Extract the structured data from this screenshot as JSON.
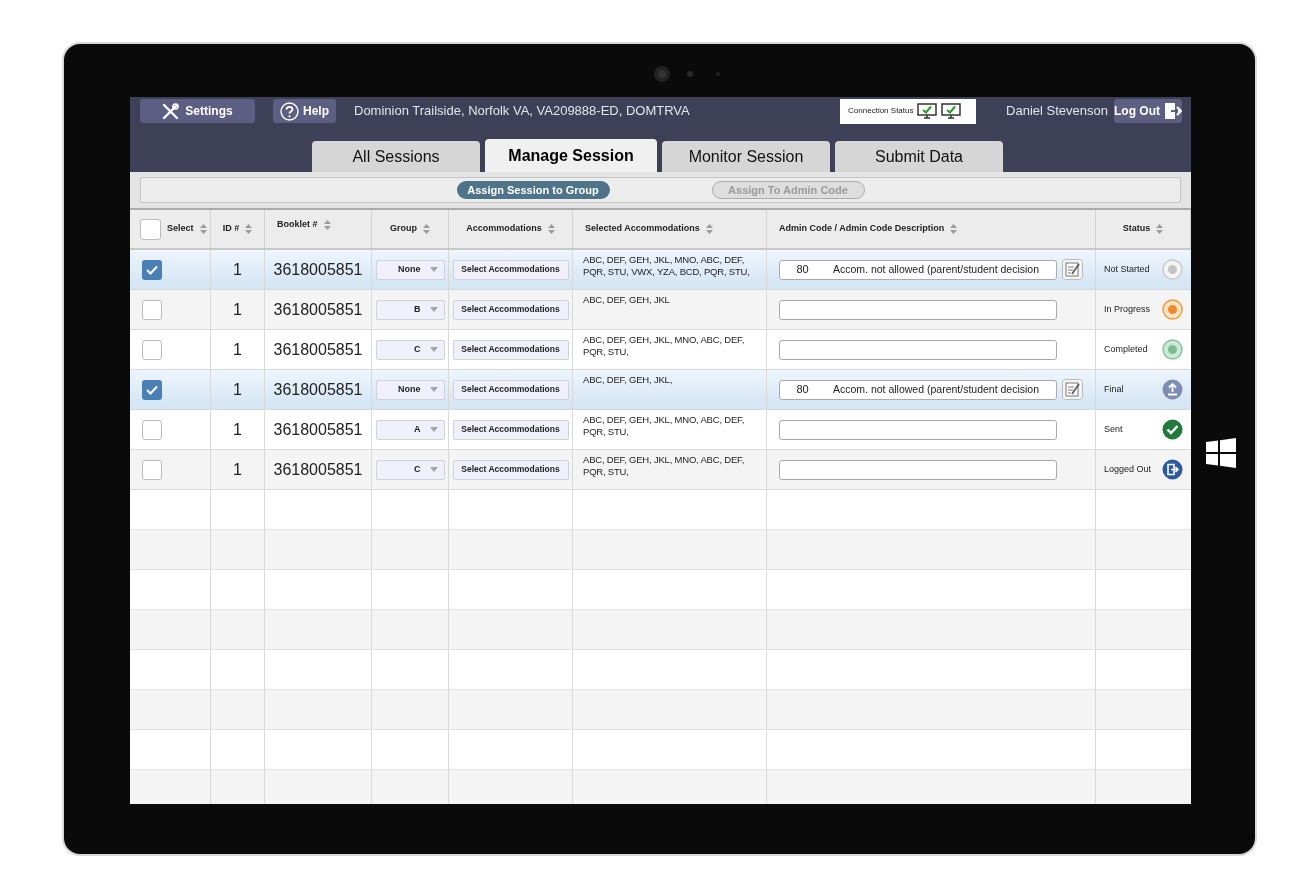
{
  "header": {
    "settings": "Settings",
    "help": "Help",
    "location": "Dominion Trailside, Norfolk VA, VA209888-ED, DOMTRVA",
    "connection_status": "Connection Status",
    "user": "Daniel Stevenson",
    "logout": "Log Out"
  },
  "tabs": [
    {
      "label": "All Sessions",
      "selected": false
    },
    {
      "label": "Manage Session",
      "selected": true
    },
    {
      "label": "Monitor Session",
      "selected": false
    },
    {
      "label": "Submit Data",
      "selected": false
    }
  ],
  "toolbar": [
    {
      "label": "Assign Session to Group",
      "disabled": false
    },
    {
      "label": "Assign To Admin Code",
      "disabled": true
    }
  ],
  "table": {
    "select_all": {
      "checked": false
    },
    "columns": [
      "Select",
      "ID #",
      "Booklet #",
      "Group",
      "Accommodations",
      "Selected Accommodations",
      "Admin Code / Admin Code Description",
      "Status"
    ],
    "rows": [
      {
        "selected": true,
        "id": "1",
        "booklet": "3618005851",
        "group": "None",
        "button": "Select Accommodations",
        "accommodations": "ABC, DEF, GEH, JKL, MNO, ABC, DEF, PQR, STU, VWX, YZA, BCD, PQR, STU,",
        "admin_code": "80",
        "admin_description": "Accom. not allowed (parent/student decision",
        "status": "Not Started",
        "kind": "not_started"
      },
      {
        "selected": false,
        "id": "1",
        "booklet": "3618005851",
        "group": "B",
        "button": "Select Accommodations",
        "accommodations": "ABC, DEF, GEH, JKL",
        "status": "In Progress",
        "kind": "in_progress"
      },
      {
        "selected": false,
        "id": "1",
        "booklet": "3618005851",
        "group": "C",
        "button": "Select Accommodations",
        "accommodations": "ABC, DEF, GEH, JKL, MNO, ABC, DEF, PQR, STU,",
        "status": "Completed",
        "kind": "completed"
      },
      {
        "selected": true,
        "id": "1",
        "booklet": "3618005851",
        "group": "None",
        "button": "Select Accommodations",
        "accommodations": "ABC, DEF, GEH, JKL,",
        "admin_code": "80",
        "admin_description": "Accom. not allowed (parent/student decision",
        "status": "Final",
        "kind": "final"
      },
      {
        "selected": false,
        "id": "1",
        "booklet": "3618005851",
        "group": "A",
        "button": "Select Accommodations",
        "accommodations": "ABC, DEF, GEH, JKL, MNO, ABC, DEF, PQR, STU,",
        "status": "Sent",
        "kind": "sent"
      },
      {
        "selected": false,
        "id": "1",
        "booklet": "3618005851",
        "group": "C",
        "button": "Select Accommodations",
        "accommodations": "ABC, DEF, GEH, JKL, MNO, ABC, DEF, PQR, STU,",
        "status": "Logged Out",
        "kind": "logged_out"
      }
    ]
  }
}
